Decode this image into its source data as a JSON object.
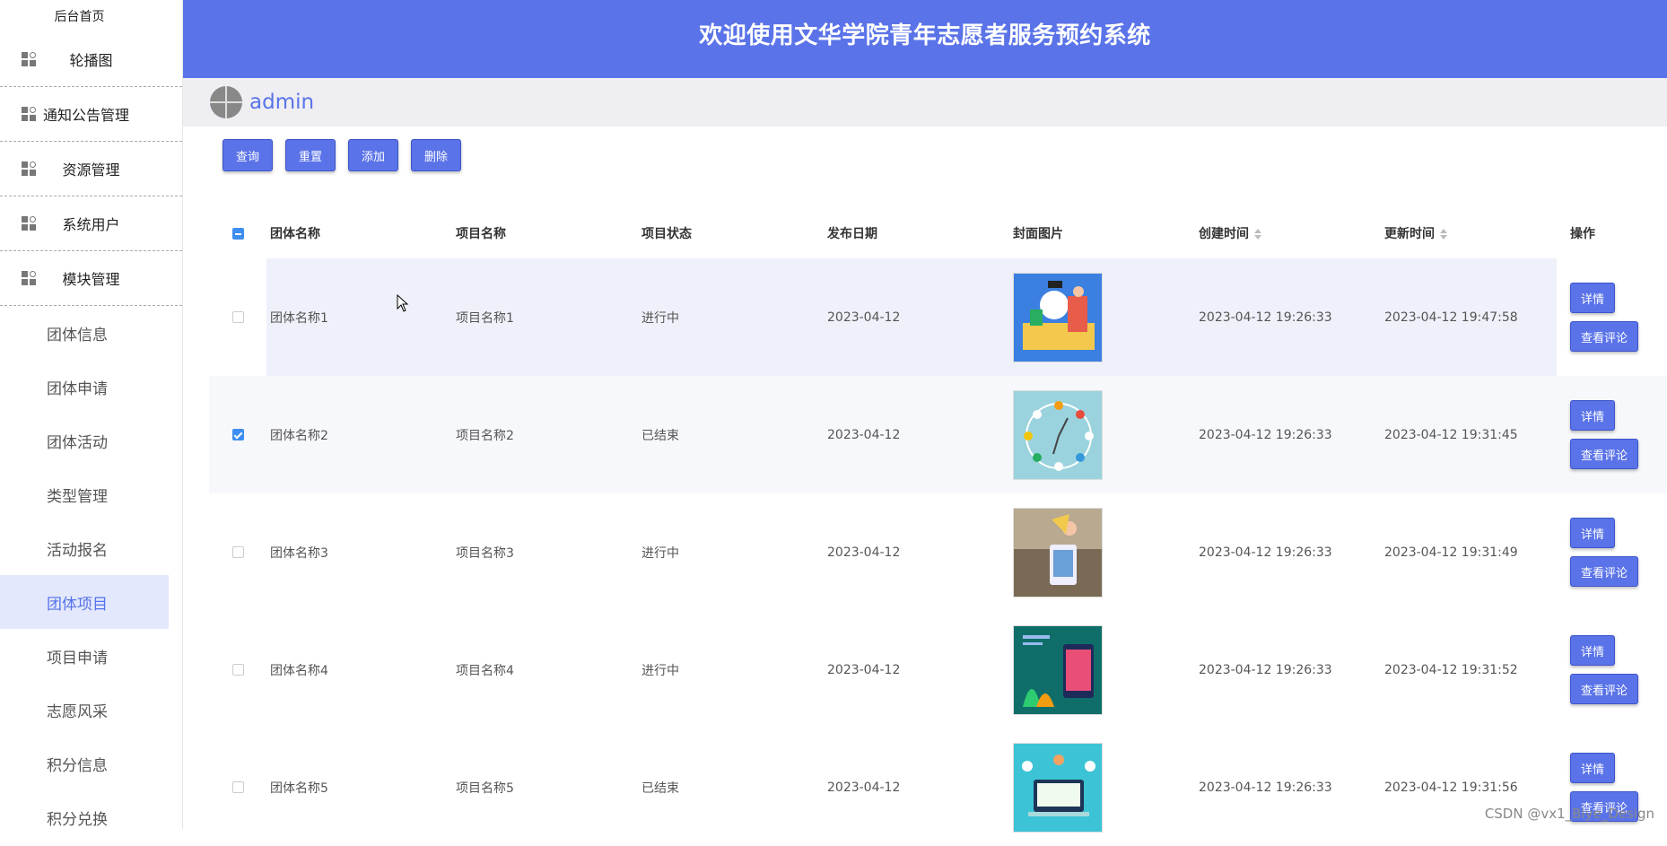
{
  "sidebar": {
    "home": "后台首页",
    "menus": [
      {
        "label": "轮播图"
      },
      {
        "label": "通知公告管理"
      },
      {
        "label": "资源管理"
      },
      {
        "label": "系统用户"
      },
      {
        "label": "模块管理"
      }
    ],
    "subitems": [
      {
        "label": "团体信息"
      },
      {
        "label": "团体申请"
      },
      {
        "label": "团体活动"
      },
      {
        "label": "类型管理"
      },
      {
        "label": "活动报名"
      },
      {
        "label": "团体项目",
        "active": true
      },
      {
        "label": "项目申请"
      },
      {
        "label": "志愿风采"
      },
      {
        "label": "积分信息"
      },
      {
        "label": "积分兑换"
      }
    ]
  },
  "header": {
    "title": "欢迎使用文华学院青年志愿者服务预约系统"
  },
  "user": {
    "name": "admin"
  },
  "toolbar": {
    "query": "查询",
    "reset": "重置",
    "add": "添加",
    "delete": "删除"
  },
  "table": {
    "columns": [
      "团体名称",
      "项目名称",
      "项目状态",
      "发布日期",
      "封面图片",
      "创建时间",
      "更新时间",
      "操作"
    ],
    "detail_label": "详情",
    "comment_label": "查看评论",
    "rows": [
      {
        "team": "团体名称1",
        "project": "项目名称1",
        "status": "进行中",
        "date": "2023-04-12",
        "created": "2023-04-12 19:26:33",
        "updated": "2023-04-12 19:47:58",
        "checked": false
      },
      {
        "team": "团体名称2",
        "project": "项目名称2",
        "status": "已结束",
        "date": "2023-04-12",
        "created": "2023-04-12 19:26:33",
        "updated": "2023-04-12 19:31:45",
        "checked": true
      },
      {
        "team": "团体名称3",
        "project": "项目名称3",
        "status": "进行中",
        "date": "2023-04-12",
        "created": "2023-04-12 19:26:33",
        "updated": "2023-04-12 19:31:49",
        "checked": false
      },
      {
        "team": "团体名称4",
        "project": "项目名称4",
        "status": "进行中",
        "date": "2023-04-12",
        "created": "2023-04-12 19:26:33",
        "updated": "2023-04-12 19:31:52",
        "checked": false
      },
      {
        "team": "团体名称5",
        "project": "项目名称5",
        "status": "已结束",
        "date": "2023-04-12",
        "created": "2023-04-12 19:26:33",
        "updated": "2023-04-12 19:31:56",
        "checked": false
      }
    ]
  },
  "watermark": "CSDN @vx1_Biye_Design",
  "colors": {
    "primary": "#5a73e8",
    "sidebar_active_bg": "#e3e8fc",
    "checkbox": "#3d8ef0"
  }
}
